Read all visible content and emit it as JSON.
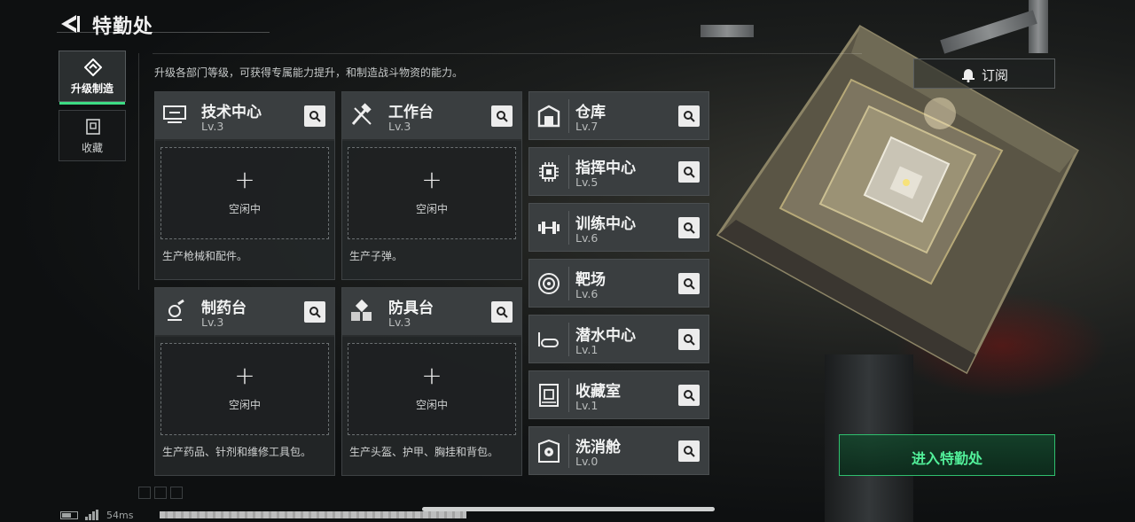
{
  "header": {
    "title": "特勤处"
  },
  "side_tabs": [
    {
      "label": "升级制造",
      "active": true
    },
    {
      "label": "收藏",
      "active": false
    }
  ],
  "description": "升级各部门等级，可获得专属能力提升，和制造战斗物资的能力。",
  "workbenches": [
    {
      "name": "技术中心",
      "level": "Lv.3",
      "slot_plus": "+",
      "slot_status": "空闲中",
      "desc": "生产枪械和配件。",
      "icon": "tech-center-icon"
    },
    {
      "name": "工作台",
      "level": "Lv.3",
      "slot_plus": "+",
      "slot_status": "空闲中",
      "desc": "生产子弹。",
      "icon": "tools-icon"
    },
    {
      "name": "制药台",
      "level": "Lv.3",
      "slot_plus": "+",
      "slot_status": "空闲中",
      "desc": "生产药品、针剂和维修工具包。",
      "icon": "microscope-icon"
    },
    {
      "name": "防具台",
      "level": "Lv.3",
      "slot_plus": "+",
      "slot_status": "空闲中",
      "desc": "生产头盔、护甲、胸挂和背包。",
      "icon": "armor-cubes-icon"
    }
  ],
  "facilities": [
    {
      "name": "仓库",
      "level": "Lv.7",
      "icon": "warehouse-icon"
    },
    {
      "name": "指挥中心",
      "level": "Lv.5",
      "icon": "command-chip-icon"
    },
    {
      "name": "训练中心",
      "level": "Lv.6",
      "icon": "dumbbell-icon"
    },
    {
      "name": "靶场",
      "level": "Lv.6",
      "icon": "target-icon"
    },
    {
      "name": "潜水中心",
      "level": "Lv.1",
      "icon": "diving-mask-icon"
    },
    {
      "name": "收藏室",
      "level": "Lv.1",
      "icon": "collection-room-icon"
    },
    {
      "name": "洗消舱",
      "level": "Lv.0",
      "icon": "decontamination-icon"
    }
  ],
  "subscribe": {
    "label": "订阅"
  },
  "enter_button": {
    "label": "进入特勤处"
  },
  "status_bar": {
    "ping": "54ms"
  },
  "colors": {
    "accent": "#3ddc84",
    "card_header": "#3a3e40",
    "card_body": "#242728"
  }
}
